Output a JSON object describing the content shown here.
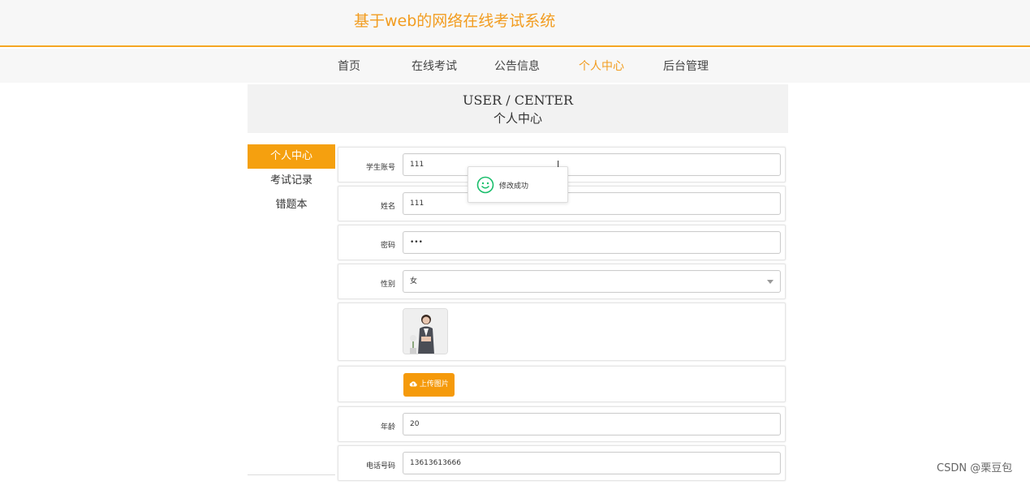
{
  "site": {
    "title": "基于web的网络在线考试系统"
  },
  "nav": [
    {
      "label": "首页",
      "active": false
    },
    {
      "label": "在线考试",
      "active": false
    },
    {
      "label": "公告信息",
      "active": false
    },
    {
      "label": "个人中心",
      "active": true
    },
    {
      "label": "后台管理",
      "active": false
    }
  ],
  "banner": {
    "en": "USER / CENTER",
    "cn": "个人中心"
  },
  "sidebar": {
    "items": [
      {
        "label": "个人中心",
        "active": true
      },
      {
        "label": "考试记录",
        "active": false
      },
      {
        "label": "错题本",
        "active": false
      }
    ]
  },
  "form": {
    "account": {
      "label": "学生账号",
      "value": "111"
    },
    "name": {
      "label": "姓名",
      "value": "111"
    },
    "password": {
      "label": "密码",
      "value": "•••"
    },
    "gender": {
      "label": "性别",
      "value": "女"
    },
    "upload": {
      "label": "上传图片",
      "icon": "cloud-upload-icon"
    },
    "age": {
      "label": "年龄",
      "value": "20"
    },
    "phone": {
      "label": "电话号码",
      "value": "13613613666"
    }
  },
  "toast": {
    "message": "修改成功",
    "icon": "smile-icon",
    "color": "#19be6b"
  },
  "watermark": "CSDN @栗豆包",
  "colors": {
    "accent": "#f29c1f",
    "button": "#f59a0b"
  }
}
